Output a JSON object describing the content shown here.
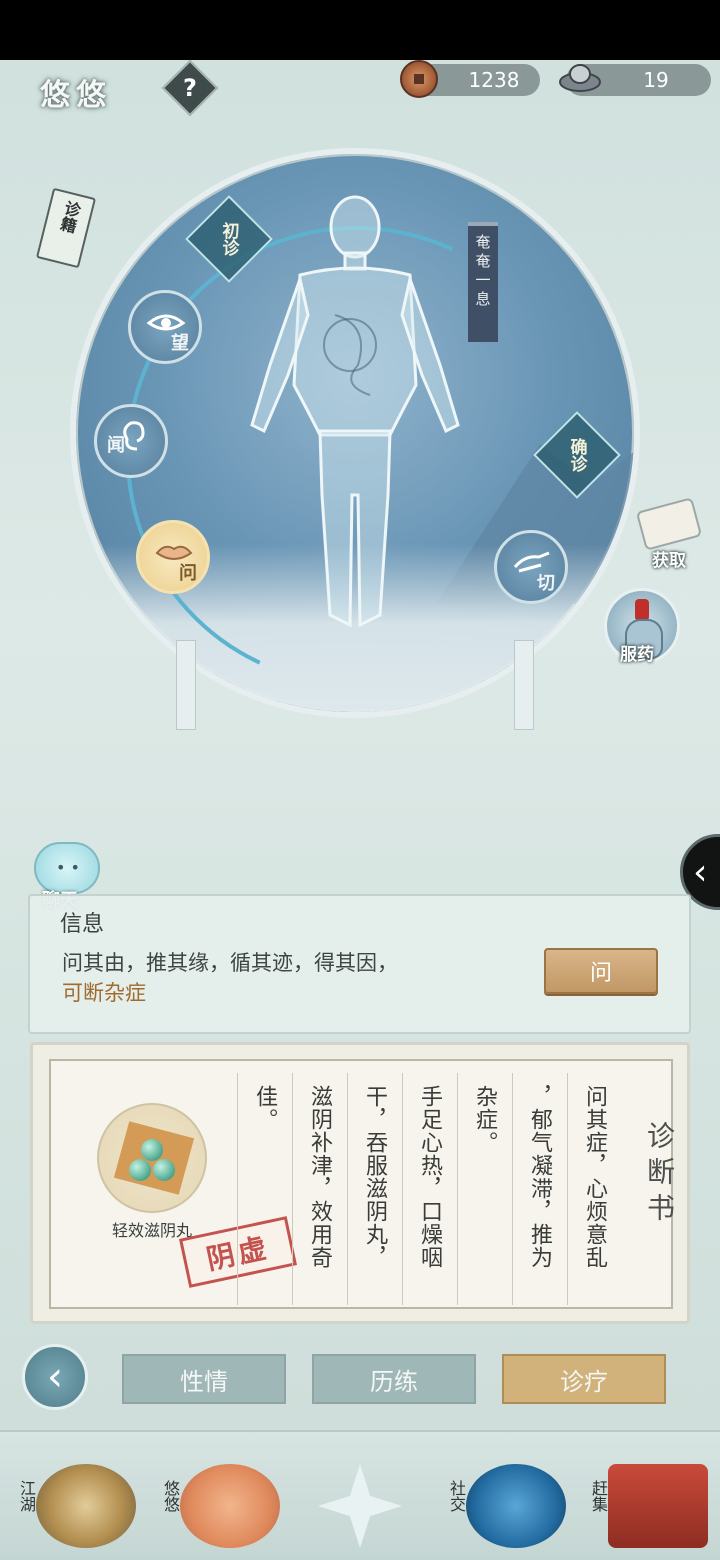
{
  "header": {
    "title": "悠悠",
    "help_label": "?",
    "copper_coins": "1238",
    "silver": "19"
  },
  "book": {
    "label": "诊籍"
  },
  "diagnosis_stage": {
    "initial": "初诊",
    "confirmed": "确诊",
    "banner": "奄奄一息"
  },
  "methods": [
    {
      "label": "望",
      "icon": "eye-icon"
    },
    {
      "label": "闻",
      "icon": "ear-icon"
    },
    {
      "label": "问",
      "icon": "lips-icon",
      "active": true
    },
    {
      "label": "切",
      "icon": "hand-icon"
    }
  ],
  "side": {
    "obtain": "获取",
    "medicine": "服药"
  },
  "chat": {
    "label": "聊天"
  },
  "info": {
    "title": "信息",
    "text": "问其由，推其缘，循其迹，得其因，",
    "highlight": "可断杂症",
    "ask_button": "问"
  },
  "diagnosis_book": {
    "title": "诊断书",
    "remedy_name": "轻效滋阴丸",
    "stamp": "阴虚",
    "columns": [
      "问其症，心烦意乱",
      "，郁气凝滞，推为",
      "杂症。",
      "手足心热，口燥咽",
      "干，吞服滋阴丸，",
      "滋阴补津，效用奇",
      "佳。"
    ]
  },
  "tabs": {
    "personality": "性情",
    "training": "历练",
    "treatment": "诊疗"
  },
  "nav": {
    "jianghu": "江湖",
    "youyou": "悠悠",
    "social": "社交",
    "market": "赶集"
  },
  "colors": {
    "accent_gold": "#d2b27b",
    "highlight_text": "#a26b2e",
    "stamp_red": "#c4534f"
  }
}
